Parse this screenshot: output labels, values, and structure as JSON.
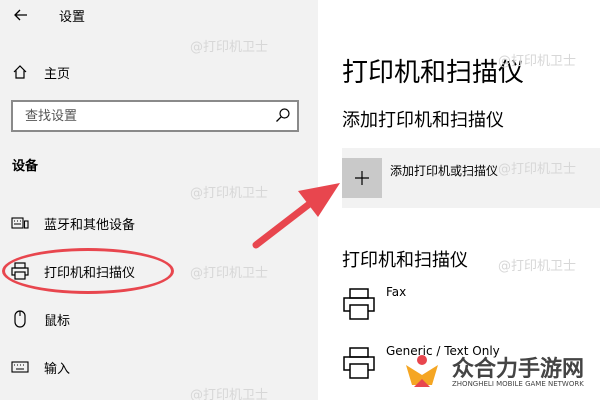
{
  "window": {
    "title": "设置"
  },
  "sidebar": {
    "home_label": "主页",
    "search_placeholder": "查找设置",
    "section_heading": "设备",
    "items": [
      {
        "label": "蓝牙和其他设备",
        "icon": "keyboard-icon"
      },
      {
        "label": "打印机和扫描仪",
        "icon": "printer-icon",
        "selected": true
      },
      {
        "label": "鼠标",
        "icon": "mouse-icon"
      },
      {
        "label": "输入",
        "icon": "keyboard-icon"
      }
    ]
  },
  "main": {
    "title": "打印机和扫描仪",
    "add_section_heading": "添加打印机和扫描仪",
    "add_button_label": "添加打印机或扫描仪",
    "printers_section_heading": "打印机和扫描仪",
    "printers": [
      {
        "name": "Fax"
      },
      {
        "name": "Generic / Text Only"
      }
    ]
  },
  "watermark": {
    "text": "@打印机卫士"
  },
  "brand": {
    "name": "众合力手游网",
    "subtitle": "ZHONGHELI MOBILE GAME NETWORK"
  },
  "colors": {
    "sidebar_bg": "#f2f2f2",
    "annotation_red": "#e8464e",
    "add_tile_bg": "#c9c9c9"
  }
}
